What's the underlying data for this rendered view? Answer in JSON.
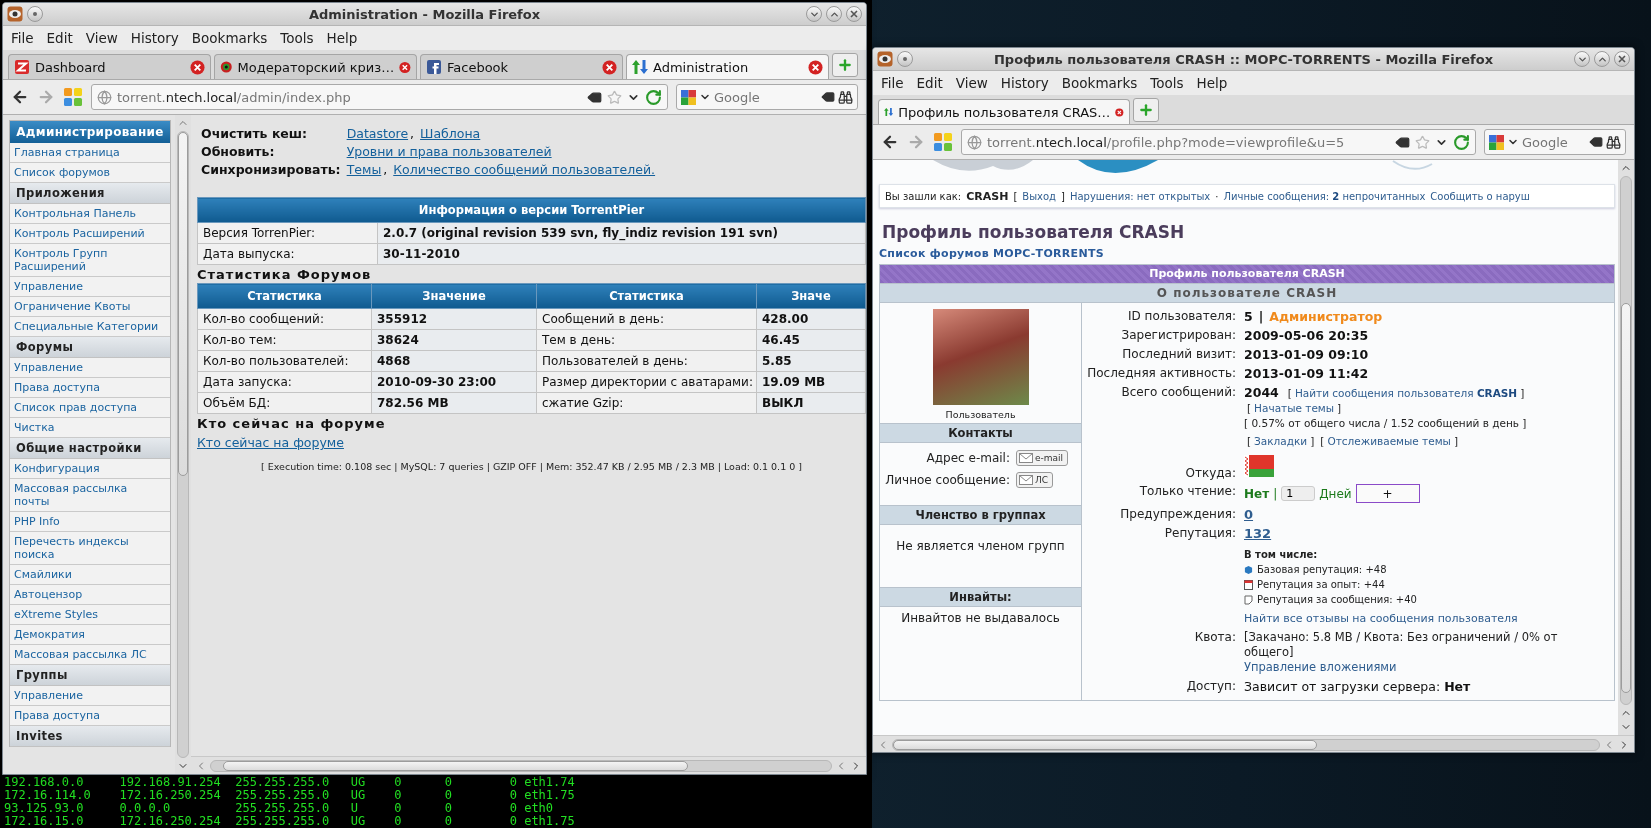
{
  "terminal": {
    "lines": [
      "192.168.0.0     192.168.91.254  255.255.255.0   UG    0      0        0 eth1.74",
      "172.16.114.0    172.16.250.254  255.255.255.0   UG    0      0        0 eth1.75",
      "93.125.93.0     0.0.0.0         255.255.255.0   U     0      0        0 eth0",
      "172.16.15.0     172.16.250.254  255.255.255.0   UG    0      0        0 eth1.75"
    ]
  },
  "admin_window": {
    "title": "Administration - Mozilla Firefox",
    "menu": [
      "File",
      "Edit",
      "View",
      "History",
      "Bookmarks",
      "Tools",
      "Help"
    ],
    "tabs": [
      {
        "label": "Dashboard",
        "kind": "z",
        "selected": false
      },
      {
        "label": "Модераторский криз…",
        "kind": "mod",
        "selected": false
      },
      {
        "label": "Facebook",
        "kind": "f",
        "selected": false
      },
      {
        "label": "Administration",
        "kind": "arrows",
        "selected": true
      }
    ],
    "address": {
      "prefix": "torrent.",
      "host": "ntech.local",
      "path": "/admin/index.php"
    },
    "search": {
      "placeholder": "Google"
    },
    "sidebar": {
      "title": "Администрирование",
      "groups": [
        {
          "items": [
            "Главная страница",
            "Список форумов"
          ]
        },
        {
          "heading": "Приложения",
          "items": [
            "Контрольная Панель",
            "Контроль Расширений",
            "Контроль Групп Расширений",
            "Управление",
            "Ограничение Квоты",
            "Специальные Категории"
          ]
        },
        {
          "heading": "Форумы",
          "items": [
            "Управление",
            "Права доступа",
            "Список прав доступа",
            "Чистка"
          ]
        },
        {
          "heading": "Общие настройки",
          "items": [
            "Конфигурация",
            "Массовая рассылка почты",
            "PHP Info",
            "Перечесть индексы поиска",
            "Смайлики",
            "Автоцензор",
            "eXtreme Styles",
            "Демократия",
            "Массовая рассылка ЛС"
          ]
        },
        {
          "heading": "Группы",
          "items": [
            "Управление",
            "Права доступа"
          ]
        },
        {
          "heading": "Invites"
        }
      ]
    },
    "separator": ",",
    "actions": [
      {
        "label": "Очистить кеш:",
        "links": [
          "Datastore",
          "Шаблона"
        ]
      },
      {
        "label": "Обновить:",
        "links": [
          "Уровни и права пользователей"
        ]
      },
      {
        "label": "Синхронизировать:",
        "links": [
          "Темы",
          "Количество сообщений пользователей."
        ]
      }
    ],
    "version_table": {
      "title": "Информация о версии TorrentPier",
      "rows": [
        [
          "Версия TorrenPier:",
          "2.0.7 (original revision 539 svn, fly_indiz revision 191 svn)"
        ],
        [
          "Дата выпуска:",
          "30-11-2010"
        ]
      ]
    },
    "stats": {
      "title": "Статистика Форумов",
      "columns": [
        "Статистика",
        "Значение",
        "Статистика",
        "Значе"
      ],
      "rows": [
        [
          "Кол-во сообщений:",
          "355912",
          "Сообщений в день:",
          "428.00"
        ],
        [
          "Кол-во тем:",
          "38624",
          "Тем в день:",
          "46.45"
        ],
        [
          "Кол-во пользователей:",
          "4868",
          "Пользователей в день:",
          "5.85"
        ],
        [
          "Дата запуска:",
          "2010-09-30 23:00",
          "Размер директории с аватарами:",
          "19.09 MB"
        ],
        [
          "Объём БД:",
          "782.56 MB",
          "сжатие Gzip:",
          "ВЫКЛ"
        ]
      ]
    },
    "online": {
      "heading": "Кто сейчас на форуме",
      "link": "Кто сейчас на форуме"
    },
    "footer": "[ Execution time: 0.108 sec | MySQL: 7 queries | GZIP OFF | Mem: 352.47 KB / 2.95 MB / 2.3 MB | Load: 0.1 0.1 0 ]"
  },
  "profile_window": {
    "title": "Профиль пользователя CRASH :: МОРС-TORRENTS - Mozilla Firefox",
    "menu": [
      "File",
      "Edit",
      "View",
      "History",
      "Bookmarks",
      "Tools",
      "Help"
    ],
    "tabs": [
      {
        "label": "Профиль пользователя CRAS…",
        "kind": "arrows",
        "selected": true
      }
    ],
    "address": {
      "prefix": "torrent.",
      "host": "ntech.local",
      "path": "/profile.php?mode=viewprofile&u=5"
    },
    "search": {
      "placeholder": "Google"
    },
    "login_bar": {
      "label": "Вы зашли как:",
      "user": "CRASH",
      "open": "[",
      "logout": "Выход",
      "close": "]",
      "violations": "Нарушения: нет открытых",
      "dot": "·",
      "messages": "Личные сообщения: **2** непрочитанных",
      "report": "Сообщить о наруш"
    },
    "page_title": "Профиль пользователя CRASH",
    "breadcrumb": "Список форумов МОРС-TORRENTS",
    "panel_title": "Профиль пользователя CRASH",
    "about_title": "О пользователе CRASH",
    "rank": "Пользователь",
    "contacts": {
      "title": "Контакты",
      "items": [
        {
          "label": "Адрес e-mail:",
          "button": "e-mail"
        },
        {
          "label": "Личное сообщение:",
          "button": "ЛС"
        }
      ]
    },
    "groups": {
      "title": "Членство в группах",
      "text": "Не является членом групп"
    },
    "invites": {
      "title": "Инвайты:",
      "text": "Инвайтов не выдавалось"
    },
    "details": [
      {
        "kind": "id",
        "label": "ID пользователя:",
        "value": "5",
        "separator": "|",
        "role": "Администратор"
      },
      {
        "kind": "text",
        "label": "Зарегистрирован:",
        "value": "2009-05-06 20:35"
      },
      {
        "kind": "text",
        "label": "Последний визит:",
        "value": "2013-01-09 09:10"
      },
      {
        "kind": "text",
        "label": "Последняя активность:",
        "value": "2013-01-09 11:42"
      },
      {
        "kind": "posts",
        "label": "Всего сообщений:",
        "value": "2044",
        "open": "[",
        "close": "]",
        "links": [
          "Найти сообщения пользователя **CRASH**",
          "Начатые темы"
        ],
        "ratio": "[ 0.57% от общего числа / 1.52 сообщений в день ]",
        "more_links": [
          "Закладки",
          "Отслеживаемые темы"
        ]
      },
      {
        "kind": "flag",
        "label": "Откуда:"
      },
      {
        "kind": "readonly",
        "label": "Только чтение:",
        "value": "Нет",
        "separator": "|",
        "days": "1",
        "unit": "Дней",
        "button": "+"
      },
      {
        "kind": "link",
        "label": "Предупреждения:",
        "value": "0"
      },
      {
        "kind": "reputation",
        "label": "Репутация:",
        "value": "132",
        "subtitle": "В том числе:",
        "items": [
          {
            "kind": "cube",
            "text": "Базовая репутация: +48"
          },
          {
            "kind": "calendar",
            "text": "Репутация за опыт: +44"
          },
          {
            "kind": "note",
            "text": "Репутация за сообщения: +40"
          }
        ],
        "link": "Найти все отзывы на сообщения пользователя"
      },
      {
        "kind": "quota",
        "label": "Квота:",
        "value": "[Закачано: 5.8 MB / Квота: Без ограничений / 0% от общего]",
        "link": "Управление вложениями"
      },
      {
        "kind": "rich",
        "label": "Доступ:",
        "value": "Зависит от загрузки сервера: **Нет**"
      }
    ]
  }
}
